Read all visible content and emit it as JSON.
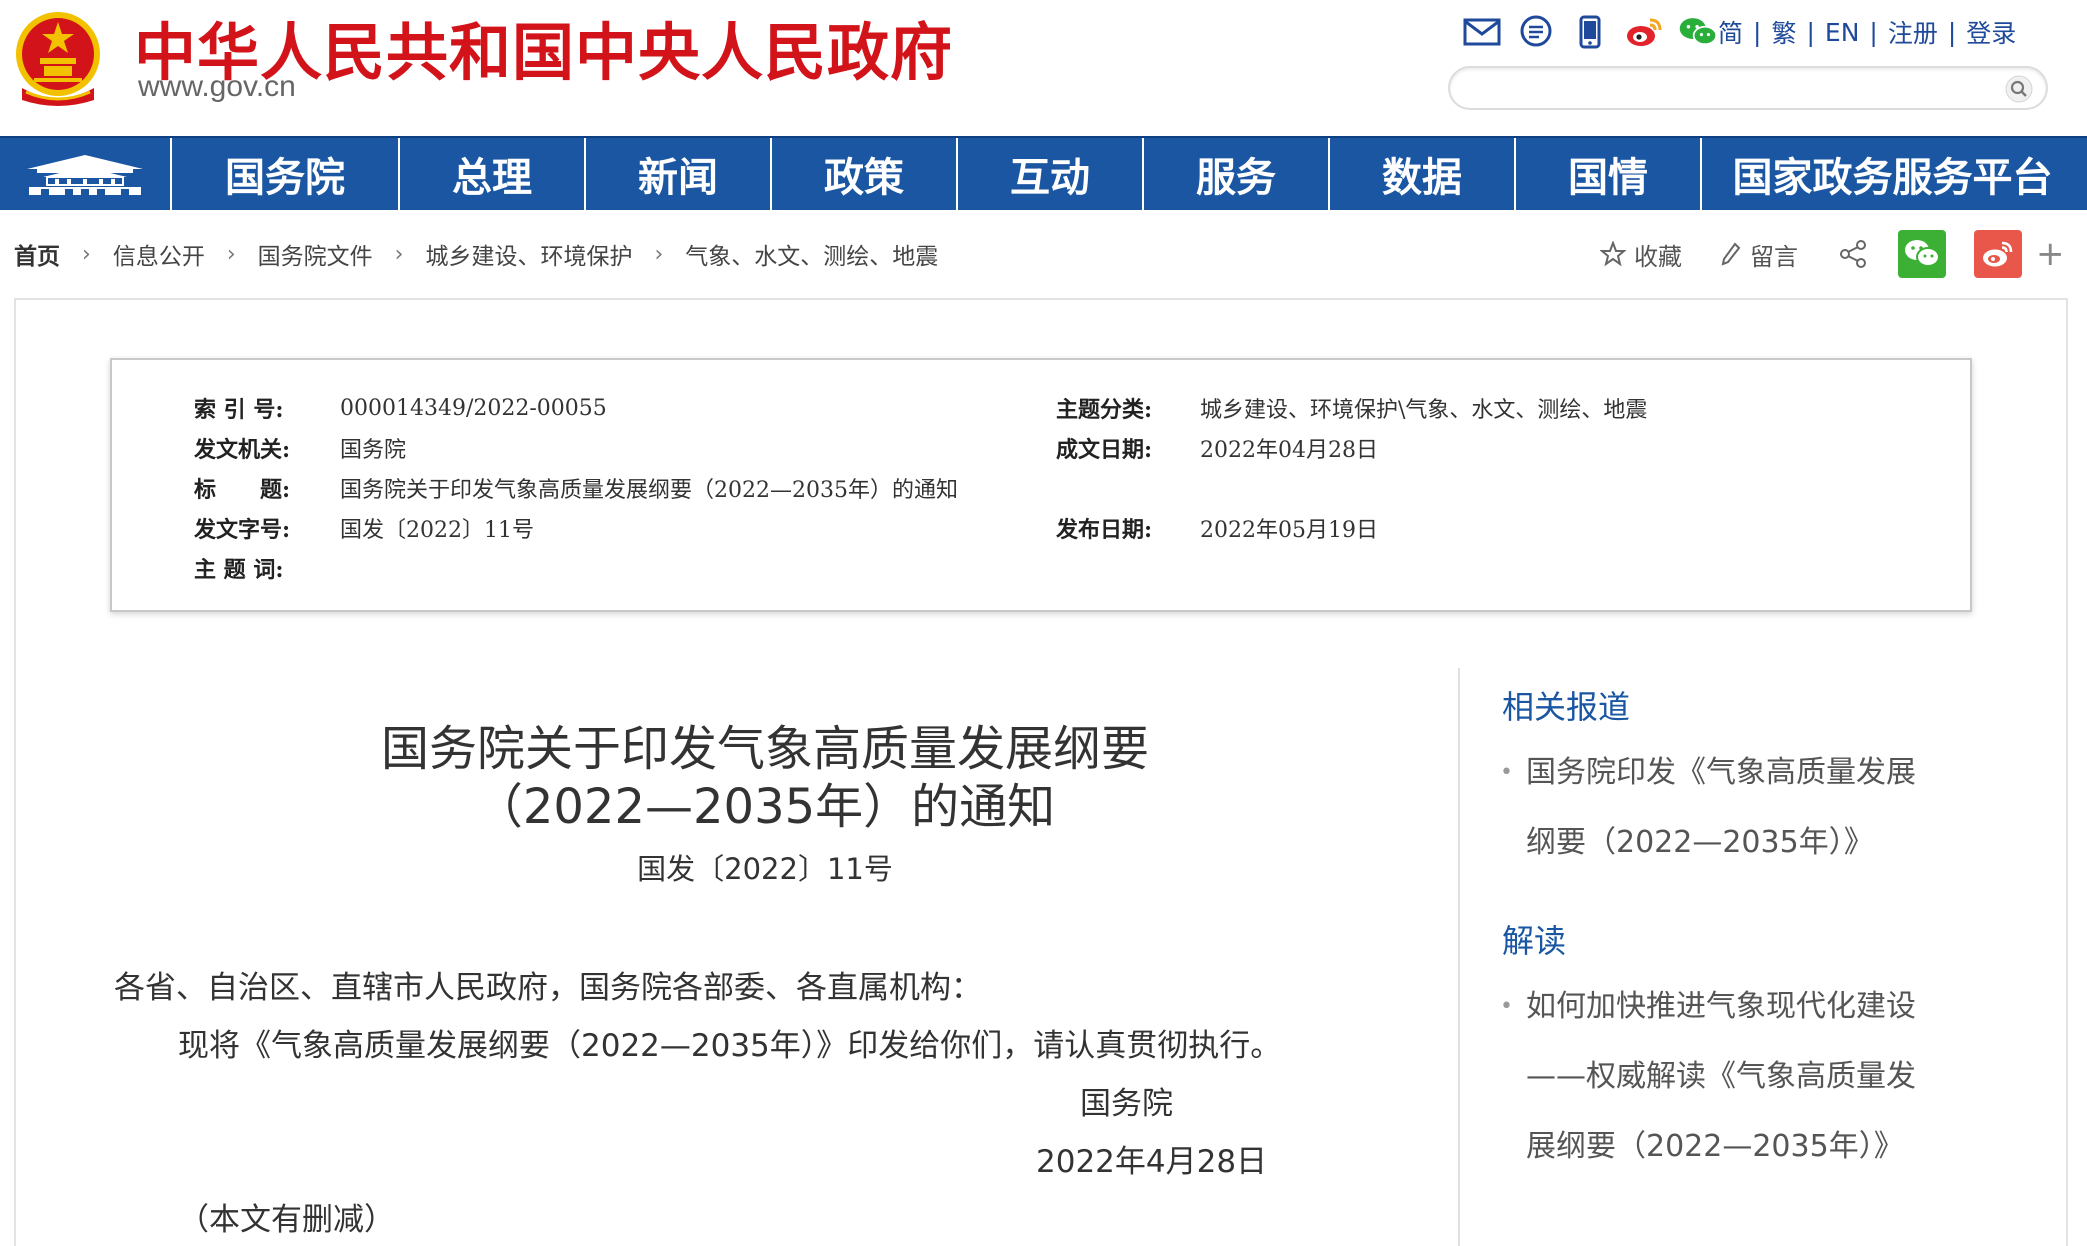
{
  "header": {
    "site_title": "中华人民共和国中央人民政府",
    "site_url": "www.gov.cn",
    "icons": [
      "mail-icon",
      "message-icon",
      "mobile-icon",
      "weibo-icon",
      "wechat-icon"
    ],
    "links": [
      "简",
      "繁",
      "EN",
      "注册",
      "登录"
    ],
    "search_placeholder": ""
  },
  "nav": {
    "items": [
      "国务院",
      "总理",
      "新闻",
      "政策",
      "互动",
      "服务",
      "数据",
      "国情",
      "国家政务服务平台"
    ]
  },
  "breadcrumb": [
    "首页",
    "信息公开",
    "国务院文件",
    "城乡建设、环境保护",
    "气象、水文、测绘、地震"
  ],
  "tools": {
    "favorite": "收藏",
    "comment": "留言",
    "plus": "+"
  },
  "meta": {
    "index_label": "索 引 号:",
    "index_value": "000014349/2022-00055",
    "topic_label": "主题分类:",
    "topic_value": "城乡建设、环境保护\\气象、水文、测绘、地震",
    "issuer_label": "发文机关:",
    "issuer_value": "国务院",
    "written_label": "成文日期:",
    "written_value": "2022年04月28日",
    "title_label": "标　　题:",
    "title_value": "国务院关于印发气象高质量发展纲要（2022—2035年）的通知",
    "docnum_label": "发文字号:",
    "docnum_value": "国发〔2022〕11号",
    "published_label": "发布日期:",
    "published_value": "2022年05月19日",
    "keywords_label": "主 题 词:",
    "keywords_value": ""
  },
  "article": {
    "title_line1": "国务院关于印发气象高质量发展纲要",
    "title_line2": "（2022—2035年）的通知",
    "doc_number": "国发〔2022〕11号",
    "salutation": "各省、自治区、直辖市人民政府，国务院各部委、各直属机构：",
    "body": "现将《气象高质量发展纲要（2022—2035年）》印发给你们，请认真贯彻执行。",
    "signer": "国务院",
    "date": "2022年4月28日",
    "note": "（本文有删减）"
  },
  "sidebar": {
    "related_heading": "相关报道",
    "related_items": [
      {
        "line1": "国务院印发《气象高质量发展",
        "line2": "纲要（2022—2035年）》"
      }
    ],
    "interpret_heading": "解读",
    "interpret_items": [
      {
        "line1": "如何加快推进气象现代化建设",
        "line2": "——权威解读《气象高质量发",
        "line3": "展纲要（2022—2035年）》"
      }
    ]
  },
  "colors": {
    "brand_red": "#d2131a",
    "nav_blue": "#1b56a3",
    "link_blue": "#1f4a9b"
  }
}
